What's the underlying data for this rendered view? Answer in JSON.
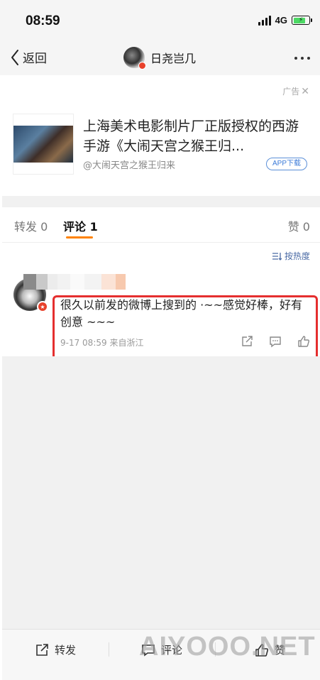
{
  "status_bar": {
    "time": "08:59",
    "network": "4G",
    "battery_level": 0.8
  },
  "nav": {
    "back_label": "返回",
    "title": "日尧岂几"
  },
  "ad": {
    "label": "广告",
    "title": "上海美术电影制片厂正版授权的西游手游《大闹天宫之猴王归...",
    "source": "@大闹天宫之猴王归来",
    "download_label": "APP下载"
  },
  "tabs": {
    "repost": "转发 0",
    "comment": "评论 1",
    "like": "赞 0"
  },
  "sort": {
    "label": "按热度"
  },
  "comment": {
    "text": "很久以前发的微博上搜到的 ·~~感觉好棒，好有创意 ~~~",
    "meta": "9-17 08:59  来自浙江"
  },
  "bottom_bar": {
    "repost": "转发",
    "comment": "评论",
    "like": "赞"
  },
  "watermark": "AIYOOO.NET",
  "colors": {
    "accent": "#ff8200",
    "highlight": "#e52e2e",
    "link": "#4a6aa5"
  }
}
